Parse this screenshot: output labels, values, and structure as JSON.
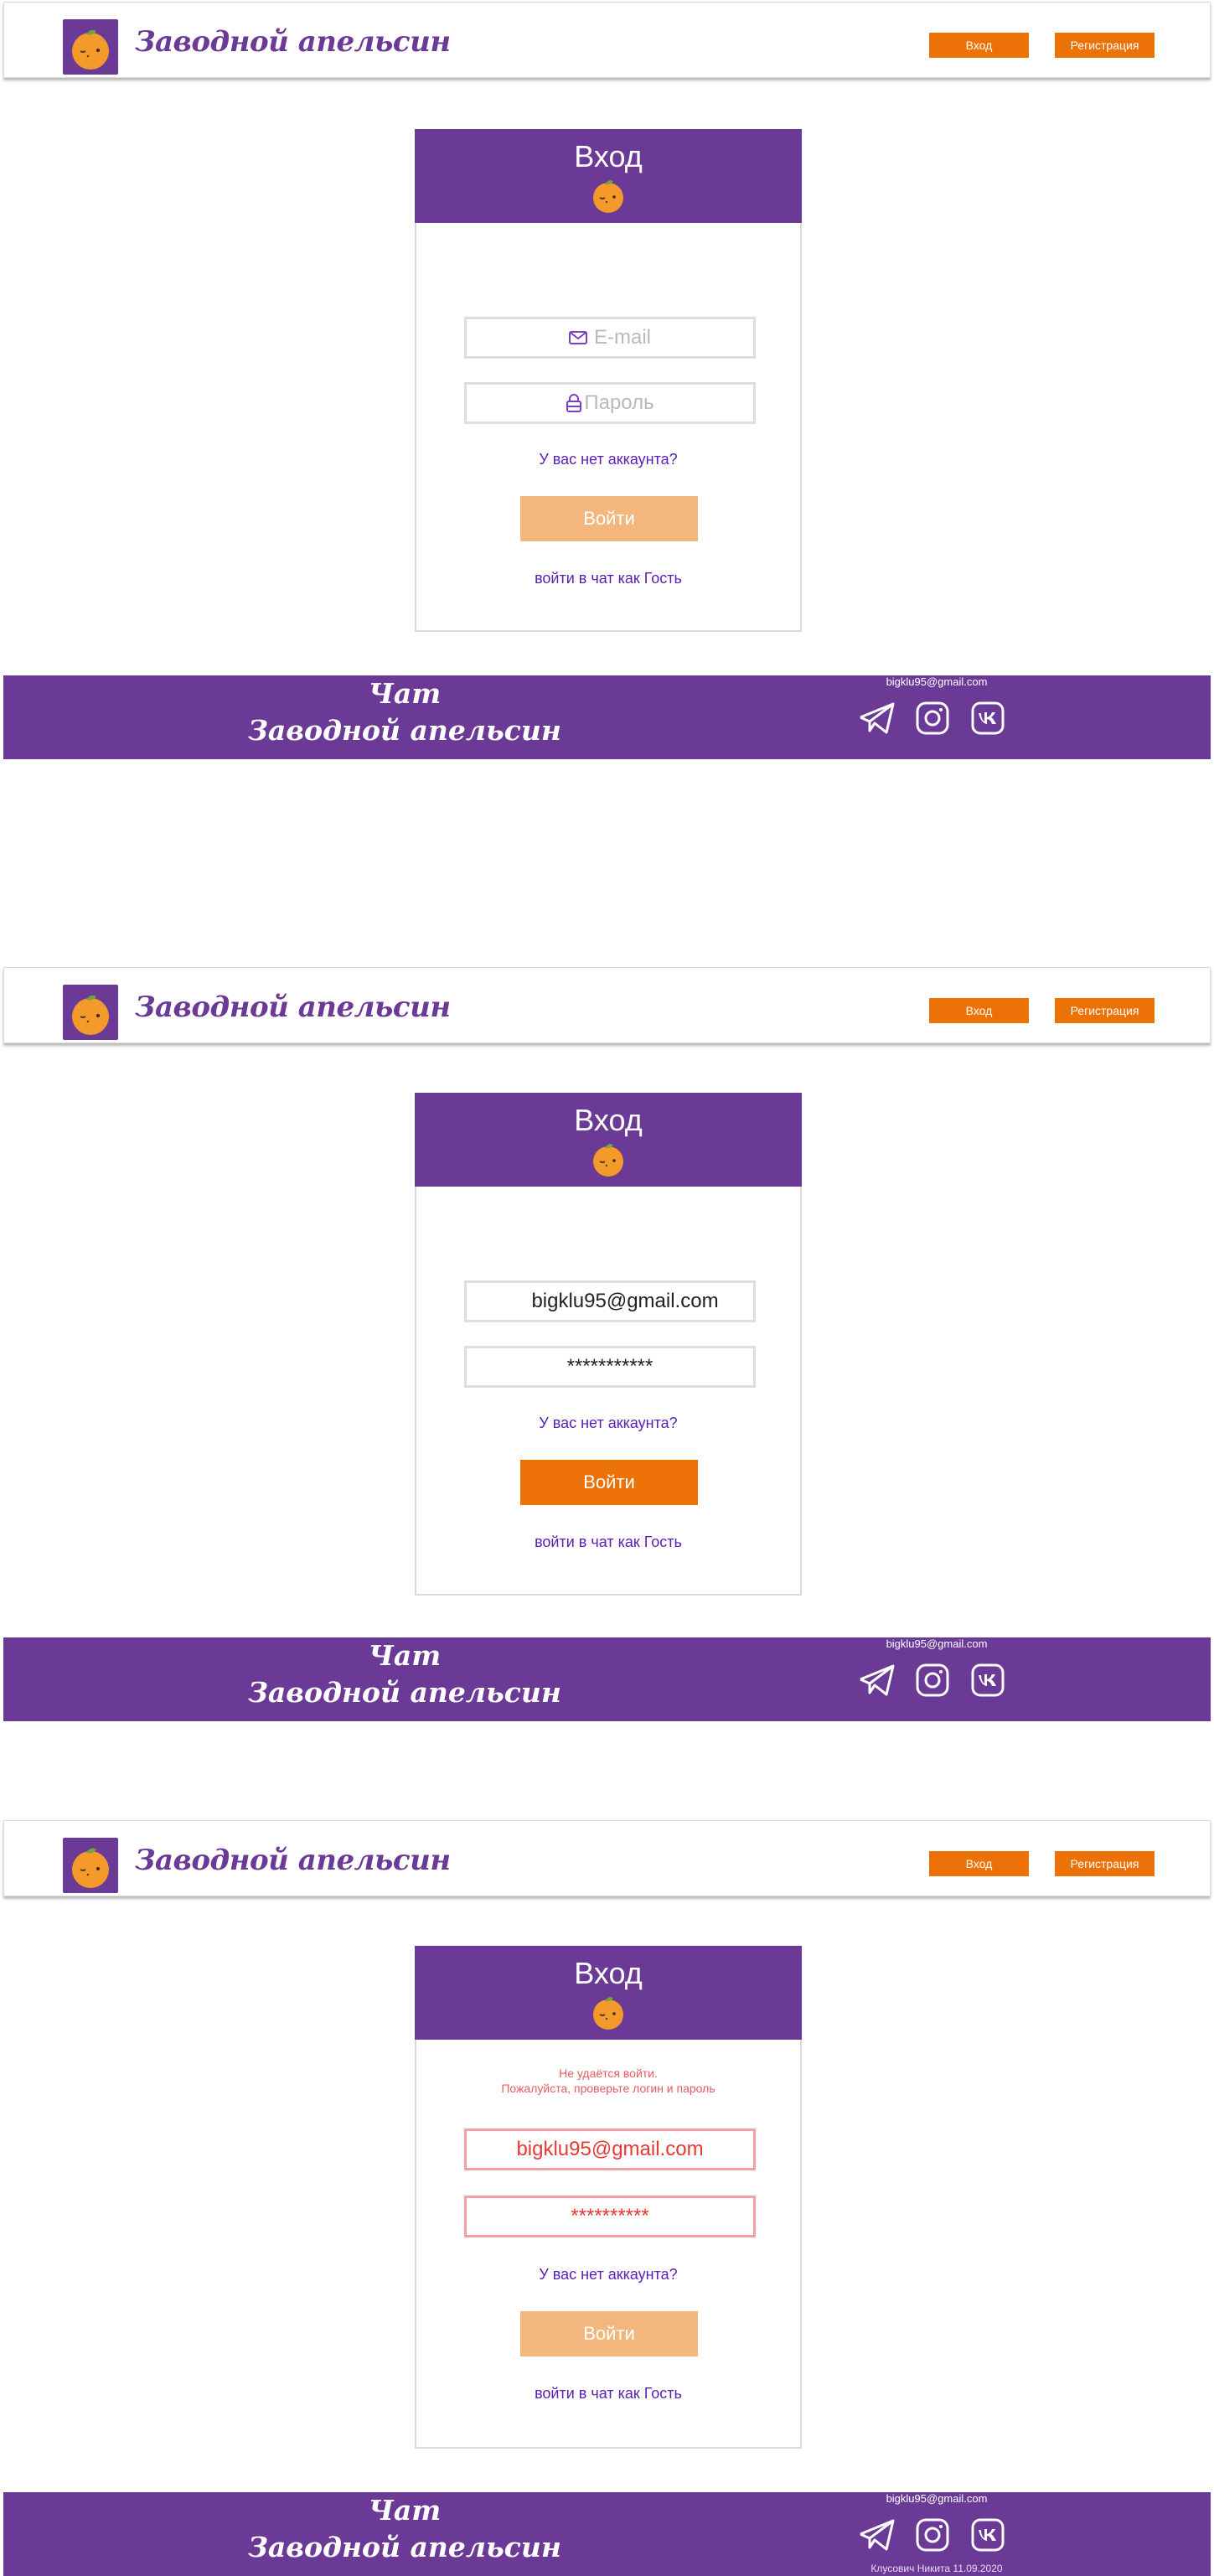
{
  "brand": {
    "name": "Заводной апельсин"
  },
  "header": {
    "login_label": "Вход",
    "register_label": "Регистрация"
  },
  "colors": {
    "primary": "#6b3a97",
    "accent": "#ec7208",
    "accent_disabled": "#f3b77e",
    "link": "#5a1db5",
    "error": "#e53935"
  },
  "screens": [
    {
      "state": "empty",
      "card": {
        "title": "Вход",
        "email_placeholder": "E-mail",
        "password_placeholder": "Пароль",
        "no_account_link": "У вас нет аккаунта?",
        "submit_label": "Войти",
        "guest_link": "войти в чат как Гость"
      }
    },
    {
      "state": "filled",
      "card": {
        "title": "Вход",
        "email_value": "bigklu95@gmail.com",
        "password_value": "***********",
        "no_account_link": "У вас нет аккаунта?",
        "submit_label": "Войти",
        "guest_link": "войти в чат как Гость"
      }
    },
    {
      "state": "error",
      "card": {
        "title": "Вход",
        "error_line1": "Не  удаётся войти.",
        "error_line2": "Пожалуйста, проверьте логин и пароль",
        "email_value": "bigklu95@gmail.com",
        "password_value": "**********",
        "no_account_link": "У вас нет аккаунта?",
        "submit_label": "Войти",
        "guest_link": "войти в чат как Гость"
      }
    }
  ],
  "footer": {
    "title_line1": "Чат",
    "title_line2": "Заводной апельсин",
    "email": "bigklu95@gmail.com",
    "copyright": "Клусович Никита  11.09.2020",
    "icons": [
      "telegram-icon",
      "instagram-icon",
      "vk-icon"
    ]
  }
}
